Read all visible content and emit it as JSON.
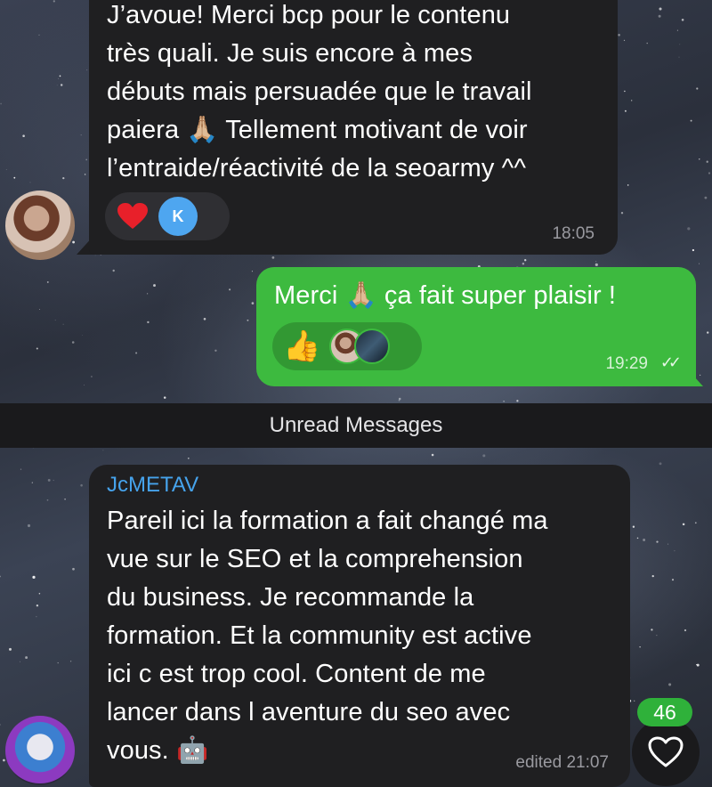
{
  "messages": [
    {
      "text": "J’avoue! Merci bcp pour le contenu\ntrès quali. Je suis encore à mes\ndébuts mais persuadée que le travail\npaiera 🙏🏼 Tellement motivant de voir\nl’entraide/réactivité de la seoarmy ^^",
      "time": "18:05",
      "reactions": [
        "heart-reaction",
        "K"
      ]
    },
    {
      "text": "Merci 🙏🏼 ça fait super plaisir !",
      "time": "19:29",
      "reactions": [
        "thumbs-up-reaction",
        "avatar",
        "avatar"
      ]
    },
    {
      "sender": "JcMETAV",
      "text": "Pareil ici la formation a fait changé ma\nvue sur le SEO et la comprehension\ndu business. Je recommande la\nformation. Et la community est active\nici c est trop cool. Content de me\nlancer dans l aventure du seo avec\nvous. 🤖",
      "time": "edited 21:07"
    }
  ],
  "unread_label": "Unread Messages",
  "like_count": "46",
  "colors": {
    "incoming_bubble": "#1f1f21",
    "outgoing_bubble": "#3dba3f",
    "sender_name": "#46a3ec",
    "badge": "#2fb13a"
  },
  "icons": [
    "heart-icon",
    "thumbs-up-icon",
    "double-check-icon",
    "like-heart-icon"
  ]
}
